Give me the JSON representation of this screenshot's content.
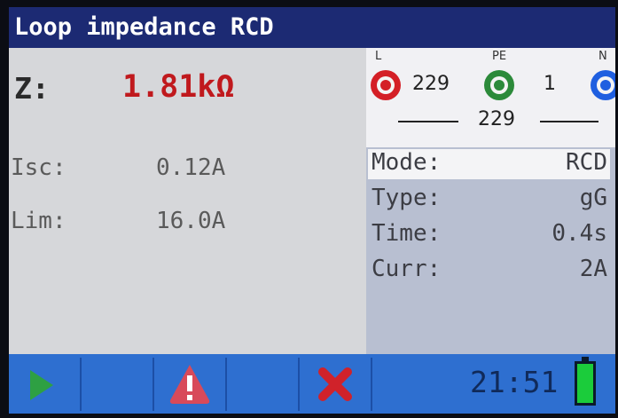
{
  "title": "Loop impedance RCD",
  "result": {
    "z_label": "Z:",
    "z_value": "1.81kΩ",
    "isc_label": "Isc:",
    "isc_value": "0.12A",
    "lim_label": "Lim:",
    "lim_value": "16.0A"
  },
  "terminals": {
    "l_label": "L",
    "pe_label": "PE",
    "n_label": "N",
    "l_pe_value": "229",
    "pe_n_value": "1",
    "l_n_value": "229"
  },
  "settings": [
    {
      "label": "Mode:",
      "value": "RCD"
    },
    {
      "label": "Type:",
      "value": "gG"
    },
    {
      "label": "Time:",
      "value": "0.4s"
    },
    {
      "label": "Curr:",
      "value": "2A"
    }
  ],
  "status": {
    "clock": "21:51"
  },
  "colors": {
    "title_bg": "#1c2a73",
    "z_value": "#c0191d",
    "bottom_bar": "#2e6fd0",
    "start_icon": "#2ea043",
    "warning_icon": "#d84a5a",
    "cancel_icon": "#d0222a",
    "battery": "#1bcc3b"
  },
  "icons": {
    "start": "play-icon",
    "warning": "warning-icon",
    "cancel": "close-icon",
    "battery": "battery-icon"
  }
}
